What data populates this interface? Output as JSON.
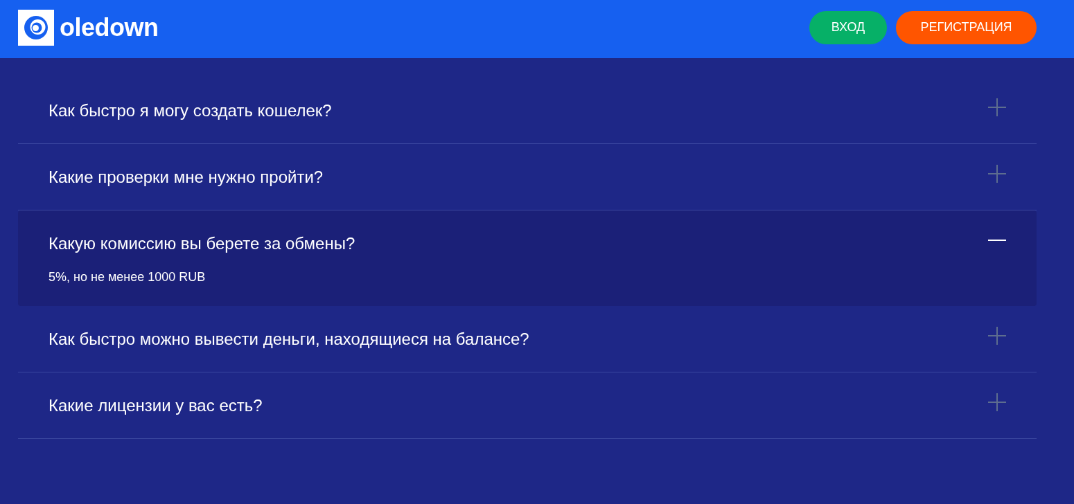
{
  "header": {
    "logo": {
      "text": "oledown"
    },
    "buttons": [
      {
        "label": "ВХОД",
        "kind": "login"
      },
      {
        "label": "РЕГИСТРАЦИЯ",
        "kind": "register"
      }
    ]
  },
  "faq": {
    "items": [
      {
        "question": "Как быстро я могу создать кошелек?",
        "expanded": false
      },
      {
        "question": "Какие проверки мне нужно пройти?",
        "expanded": false
      },
      {
        "question": "Какую комиссию вы берете за обмены?",
        "expanded": true,
        "answer": "5%, но не менее 1000 RUB"
      },
      {
        "question": "Как быстро можно вывести деньги, находящиеся на балансе?",
        "expanded": false
      },
      {
        "question": "Какие лицензии у вас есть?",
        "expanded": false
      }
    ]
  }
}
